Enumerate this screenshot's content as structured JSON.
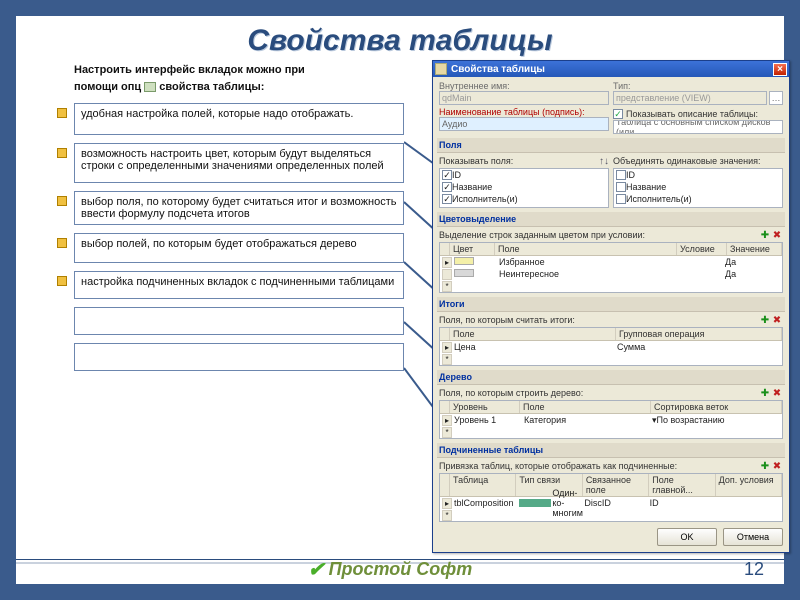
{
  "slide": {
    "title": "Свойства таблицы",
    "intro_line1": "Настроить интерфейс вкладок можно при",
    "intro_line2a": "помощи опц",
    "intro_line2b": " свойства таблицы",
    "page_number": "12",
    "brand": "Простой Софт"
  },
  "bullets": {
    "b1": "удобная настройка полей, которые надо отображать.",
    "b2": "возможность настроить цвет, которым будут выделяться строки с определенными значениями определенных полей",
    "b3": "выбор поля, по которому будет считаться итог и возможность ввести формулу подсчета итогов",
    "b4": "выбор полей, по которым будет отображаться дерево",
    "b5": "настройка подчиненных вкладок с подчиненными таблицами"
  },
  "dlg": {
    "title": "Свойства таблицы",
    "lbl_internal": "Внутреннее имя:",
    "val_internal": "qdMain",
    "lbl_type": "Тип:",
    "val_type": "представление (VIEW)",
    "lbl_caption": "Наименование таблицы (подпись):",
    "val_caption": "Аудио",
    "chk_showdesc": "Показывать описание таблицы:",
    "val_desc": "Таблица с основным списком дисков (или",
    "sec_fields": "Поля",
    "chk_show_fields": "Показывать поля:",
    "merge_same": "Объединять одинаковые значения:",
    "f_id": "ID",
    "f_name": "Название",
    "f_perf": "Исполнитель(и)",
    "sec_colors": "Цветовыделение",
    "colors_sub": "Выделение строк заданным цветом при условии:",
    "col_color": "Цвет",
    "col_field": "Поле",
    "col_cond": "Условие",
    "col_val": "Значение",
    "row1_field": "Избранное",
    "row1_val": "Да",
    "row2_field": "Неинтересное",
    "row2_val": "Да",
    "sec_totals": "Итоги",
    "totals_sub": "Поля, по которым считать итоги:",
    "tot_field": "Поле",
    "tot_op": "Групповая операция",
    "tot_r_field": "Цена",
    "tot_r_op": "Сумма",
    "sec_tree": "Дерево",
    "tree_sub": "Поля, по которым строить дерево:",
    "tree_level": "Уровень",
    "tree_field": "Поле",
    "tree_sort": "Сортировка веток",
    "tree_r_level": "Уровень 1",
    "tree_r_field": "Категория",
    "tree_r_sort": "По возрастанию",
    "sec_sub": "Подчиненные таблицы",
    "sub_sub": "Привязка таблиц, которые отображать как подчиненные:",
    "sub_col1": "Таблица",
    "sub_col2": "Тип связи",
    "sub_col3": "Связанное поле",
    "sub_col4": "Поле главной...",
    "sub_col5": "Доп. условия",
    "sub_r1": "tblComposition",
    "sub_r2": "Один-ко-многим",
    "sub_r3": "DiscID",
    "sub_r4": "ID",
    "sub_r5": "",
    "btn_ok": "OK",
    "btn_cancel": "Отмена"
  }
}
